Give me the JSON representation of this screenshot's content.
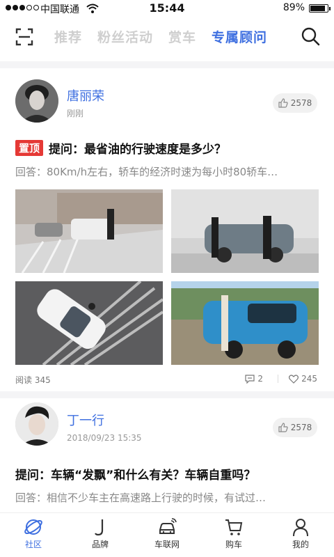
{
  "status_bar": {
    "carrier": "中国联通",
    "time": "15:44",
    "battery": "89%"
  },
  "nav": {
    "tabs": [
      {
        "label": "推荐",
        "active": false
      },
      {
        "label": "粉丝活动",
        "active": false
      },
      {
        "label": "赏车",
        "active": false
      },
      {
        "label": "专属顾问",
        "active": true
      }
    ],
    "accent_color": "#3e6fe0"
  },
  "posts": [
    {
      "author": "唐丽荣",
      "time": "刚刚",
      "likes": "2578",
      "pinned_label": "置顶",
      "question": "提问：最省油的行驶速度是多少？",
      "answer": "回答：80Km/h左右，轿车的经济时速为每小时80轿车…",
      "reads_label": "阅读",
      "reads": "345",
      "comments": "2",
      "hearts": "245"
    },
    {
      "author": "丁一行",
      "time": "2018/09/23  15:35",
      "likes": "2578",
      "question": "提问：车辆“发飘”和什么有关？车辆自重吗？",
      "answer": "回答：相信不少车主在高速路上行驶的时候，有试过…"
    }
  ],
  "tab_bar": {
    "items": [
      {
        "label": "社区",
        "icon": "planet-icon",
        "active": true
      },
      {
        "label": "品牌",
        "icon": "j-letter-icon",
        "active": false
      },
      {
        "label": "车联网",
        "icon": "connected-car-icon",
        "active": false
      },
      {
        "label": "购车",
        "icon": "cart-icon",
        "active": false
      },
      {
        "label": "我的",
        "icon": "person-icon",
        "active": false
      }
    ]
  }
}
